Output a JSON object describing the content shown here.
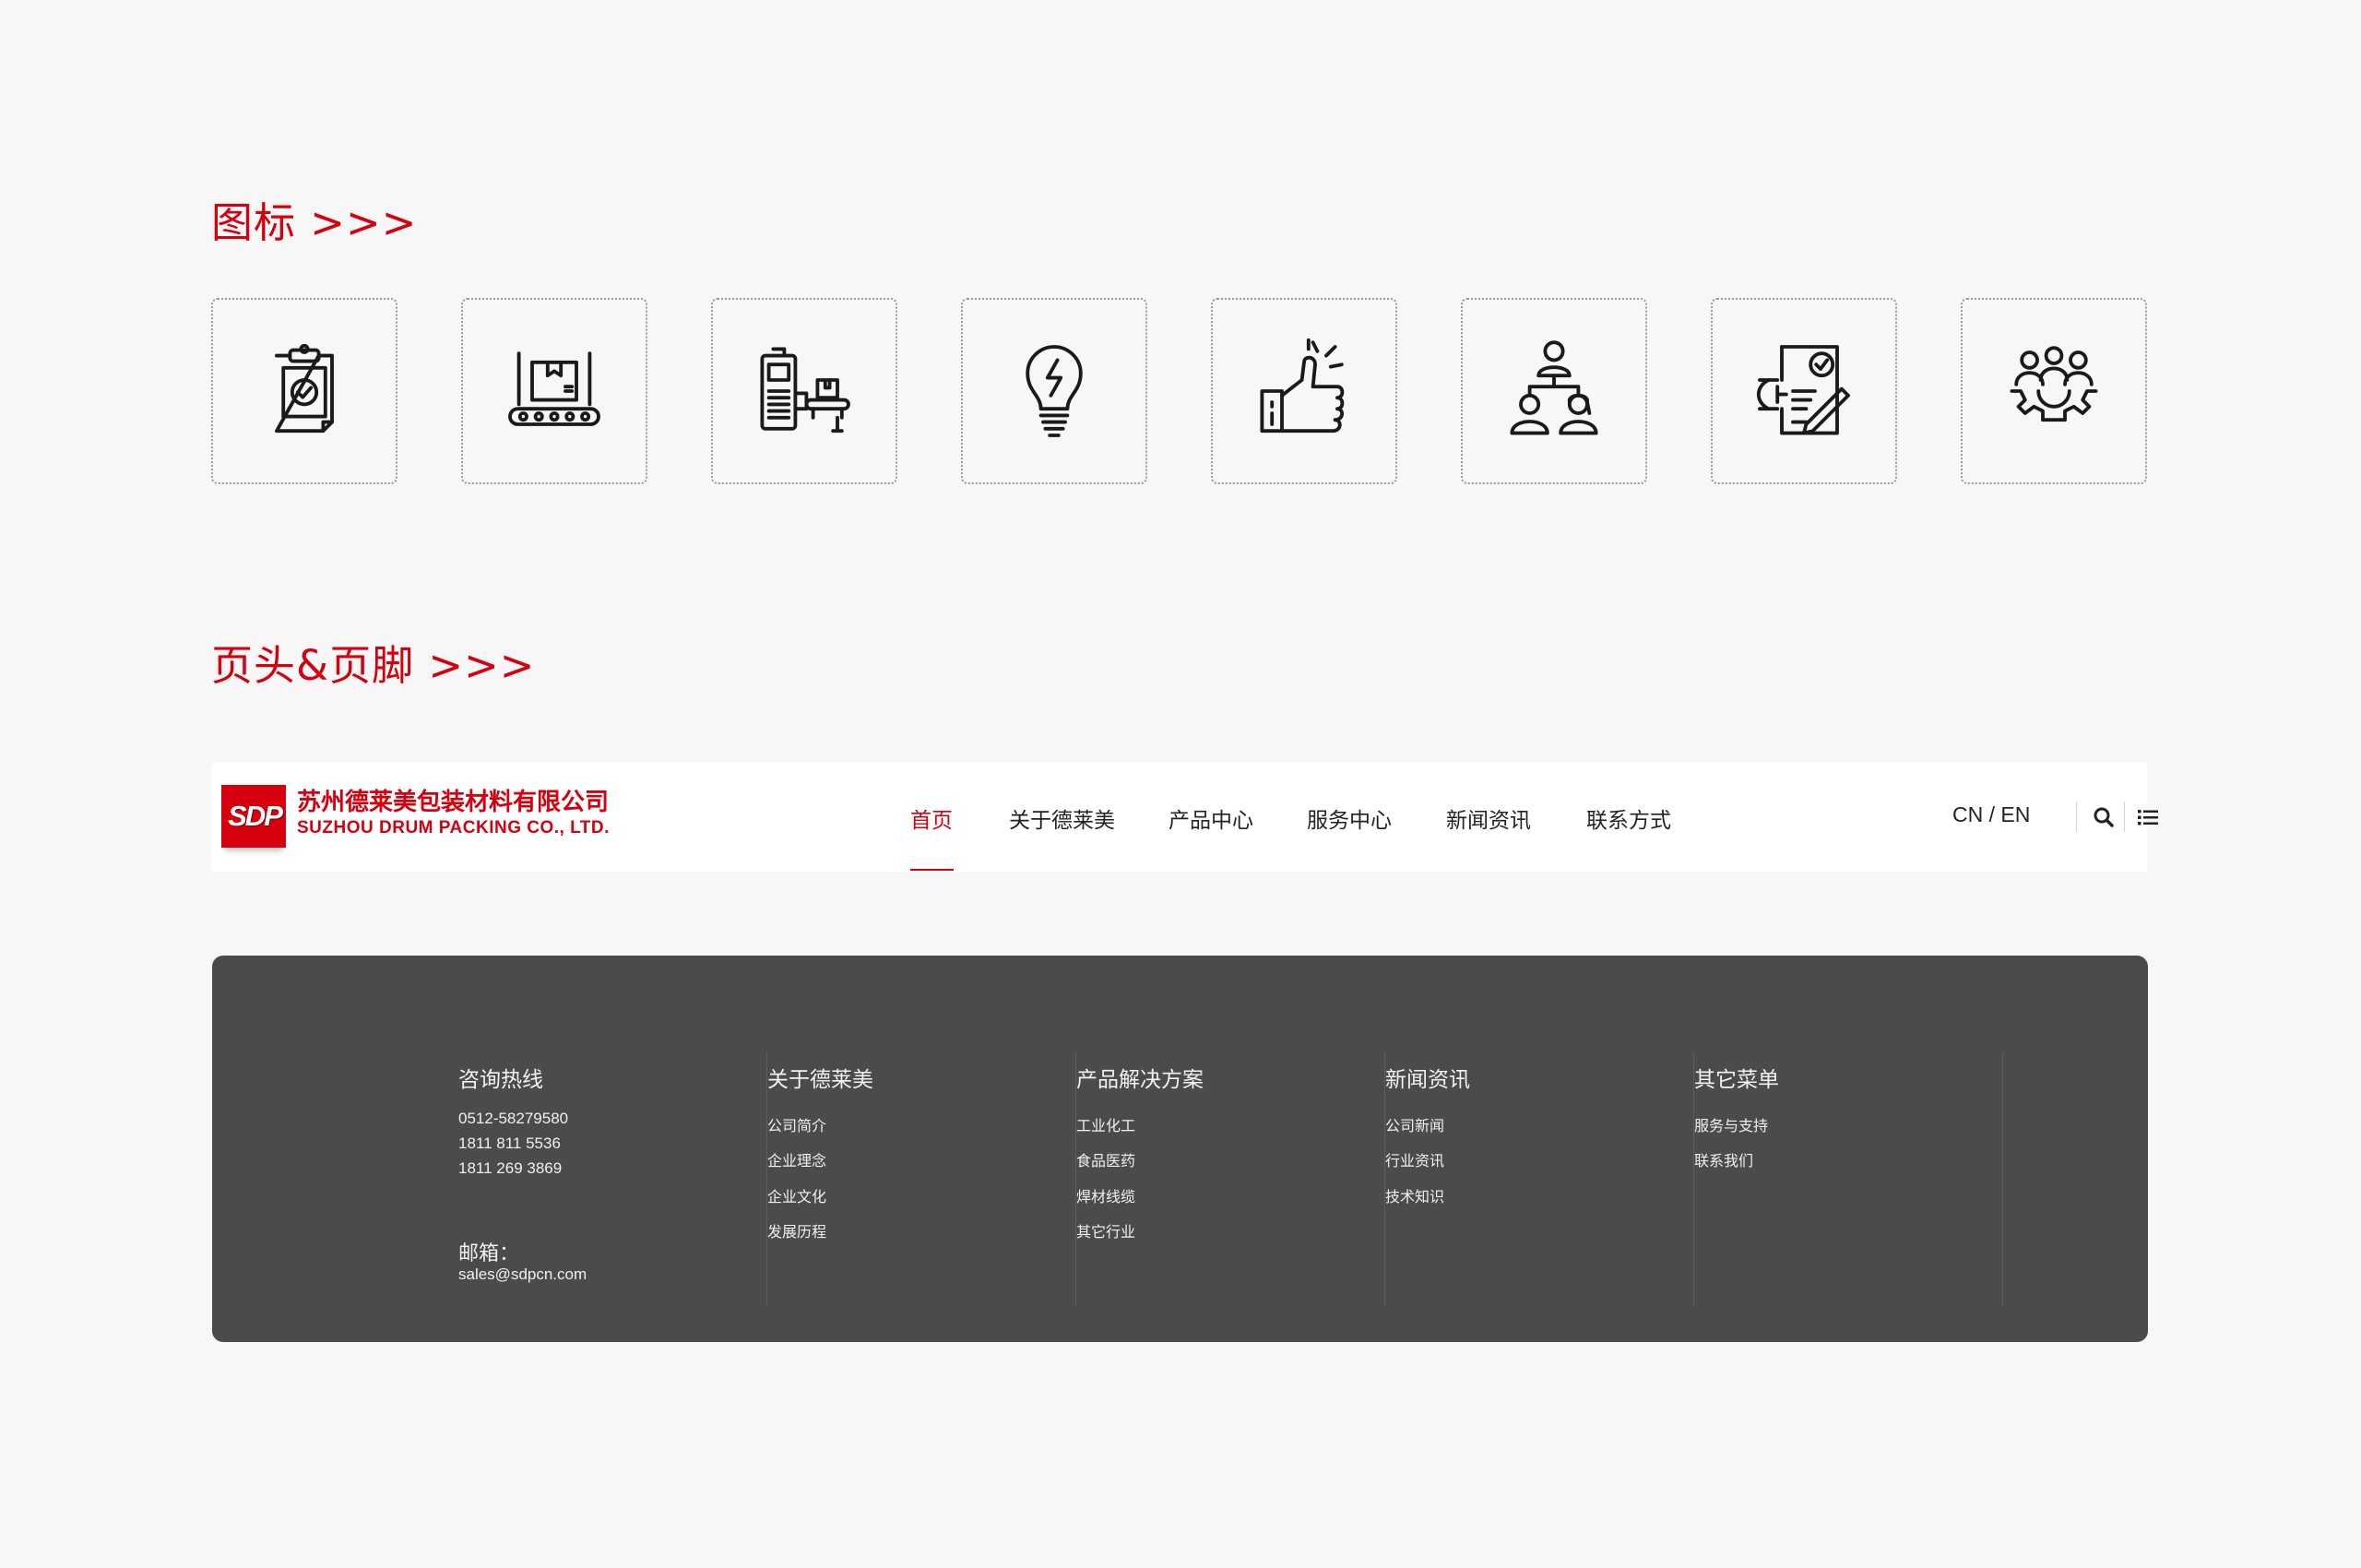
{
  "sections": {
    "icons_title": "图标 >>>",
    "header_footer_title": "页头&页脚 >>>"
  },
  "icons": [
    {
      "name": "clipboard-check-icon"
    },
    {
      "name": "conveyor-box-icon"
    },
    {
      "name": "packing-machine-icon"
    },
    {
      "name": "lightbulb-energy-icon"
    },
    {
      "name": "thumbs-up-icon"
    },
    {
      "name": "team-hierarchy-icon"
    },
    {
      "name": "document-sign-icon"
    },
    {
      "name": "team-gear-icon"
    }
  ],
  "header": {
    "logo_mark": "SDP",
    "company_cn": "苏州德莱美包装材料有限公司",
    "company_en": "SUZHOU DRUM PACKING CO., LTD.",
    "nav": [
      "首页",
      "关于德莱美",
      "产品中心",
      "服务中心",
      "新闻资讯",
      "联系方式"
    ],
    "active_nav": "首页",
    "lang": "CN / EN",
    "icons": [
      "search-icon",
      "list-menu-icon"
    ]
  },
  "footer": {
    "hotline": {
      "title": "咨询热线",
      "phones": [
        "0512-58279580",
        "1811  811 5536",
        "1811  269 3869"
      ],
      "email_label": "邮箱：",
      "email": "sales@sdpcn.com"
    },
    "columns": [
      {
        "title": "关于德莱美",
        "links": [
          "公司简介",
          "企业理念",
          "企业文化",
          "发展历程"
        ]
      },
      {
        "title": "产品解决方案",
        "links": [
          "工业化工",
          "食品医药",
          "焊材线缆",
          "其它行业"
        ]
      },
      {
        "title": "新闻资讯",
        "links": [
          "公司新闻",
          "行业资讯",
          "技术知识"
        ]
      },
      {
        "title": "其它菜单",
        "links": [
          "服务与支持",
          "联系我们"
        ]
      }
    ]
  },
  "colors": {
    "brand_red": "#d7000f",
    "footer_bg": "#4b4b4b",
    "page_bg": "#f7f7f7"
  }
}
